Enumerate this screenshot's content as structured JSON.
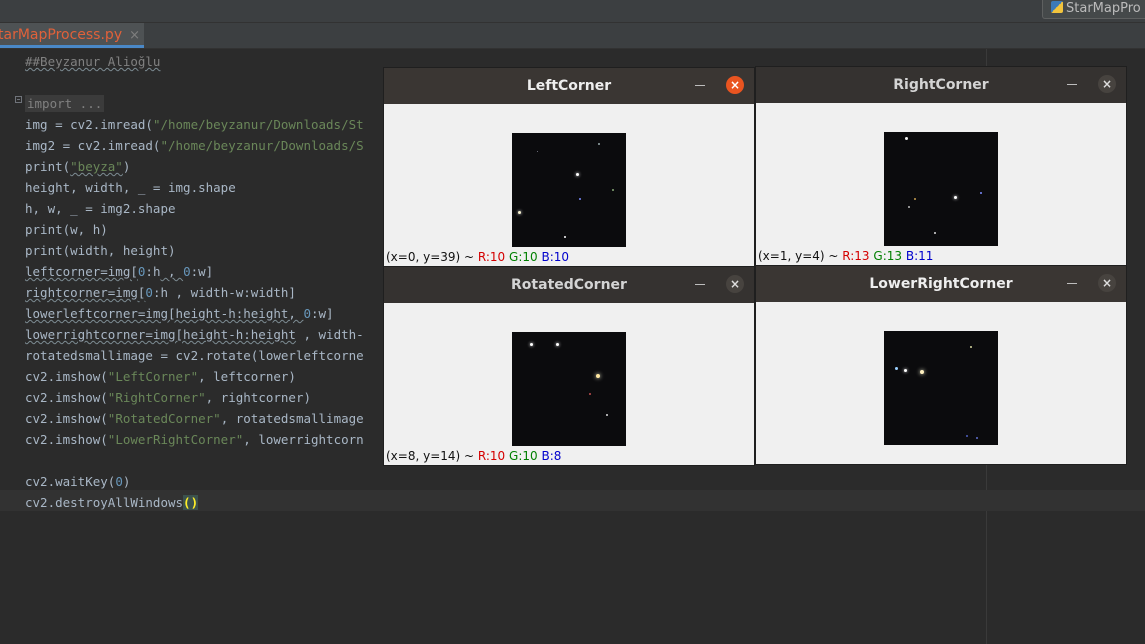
{
  "run_config": {
    "label": "StarMapPro"
  },
  "file_tab": {
    "label": "tarMapProcess.py",
    "close": "×"
  },
  "code": {
    "author_comment": "##Beyzanur Alioğlu",
    "import_fold": "import ...",
    "img_prefix": "img = cv2.imread(",
    "img_arg": "\"/home/beyzanur/Downloads/St",
    "img2_prefix": "img2 = cv2.imread(",
    "img2_arg": "\"/home/beyzanur/Downloads/S",
    "print_prefix": "print(",
    "print_arg": "\"beyza\"",
    "print_suffix": ")",
    "height_line": "height, width, _ = img.shape",
    "hw_line": "h, w, _ = img2.shape",
    "print_wh": "print(w, h)",
    "print_width_height": "print(width, height)",
    "leftcorner_a": "leftcorner=img[",
    "leftcorner_b": "0",
    "leftcorner_c": ":h",
    "leftcorner_d": " , ",
    "leftcorner_e": "0",
    "leftcorner_f": ":w]",
    "rightcorner_a": "rightcorner=img[",
    "rightcorner_b": "0",
    "rightcorner_c": ":h",
    "rightcorner_d": " , width-w:width]",
    "lowerleft_a": "lowerleftcorner=img[height-h:height, ",
    "lowerleft_b": "0",
    "lowerleft_c": ":w]",
    "lowerright_a": "lowerrightcorner=img[height-h:height",
    "lowerright_b": " , width-",
    "rotated_line": "rotatedsmallimage = cv2.rotate(lowerleftcorne",
    "imshow_prefix": "cv2.imshow(",
    "imshow1_arg": "\"LeftCorner\"",
    "imshow1_rest": ", leftcorner)",
    "imshow2_arg": "\"RightCorner\"",
    "imshow2_rest": ", rightcorner)",
    "imshow3_arg": "\"RotatedCorner\"",
    "imshow3_rest": ", rotatedsmallimage",
    "imshow4_arg": "\"LowerRightCorner\"",
    "imshow4_rest": ", lowerrightcorn",
    "waitkey_a": "cv2.waitKey(",
    "waitkey_b": "0",
    "waitkey_c": ")",
    "destroy_a": "cv2.destroyAllWindows",
    "destroy_b": "()"
  },
  "windows": [
    {
      "title": "LeftCorner",
      "min": "–",
      "close": "×",
      "status_pos": "(x=0, y=39) ~",
      "status_r": "R:10",
      "status_g": "G:10",
      "status_b": "B:10"
    },
    {
      "title": "RightCorner",
      "min": "–",
      "close": "×",
      "status_pos": "(x=1, y=4) ~",
      "status_r": "R:13",
      "status_g": "G:13",
      "status_b": "B:11"
    },
    {
      "title": "RotatedCorner",
      "min": "–",
      "close": "×",
      "status_pos": "(x=8, y=14) ~",
      "status_r": "R:10",
      "status_g": "G:10",
      "status_b": "B:8"
    },
    {
      "title": "LowerRightCorner",
      "min": "–",
      "close": "×",
      "status_pos": "",
      "status_r": "",
      "status_g": "",
      "status_b": ""
    }
  ],
  "colors": {
    "editor_bg": "#2b2b2b",
    "keyword_string": "#6a8759",
    "number": "#6897bb",
    "tab_label": "#e0613a",
    "active_close": "#e95420"
  }
}
